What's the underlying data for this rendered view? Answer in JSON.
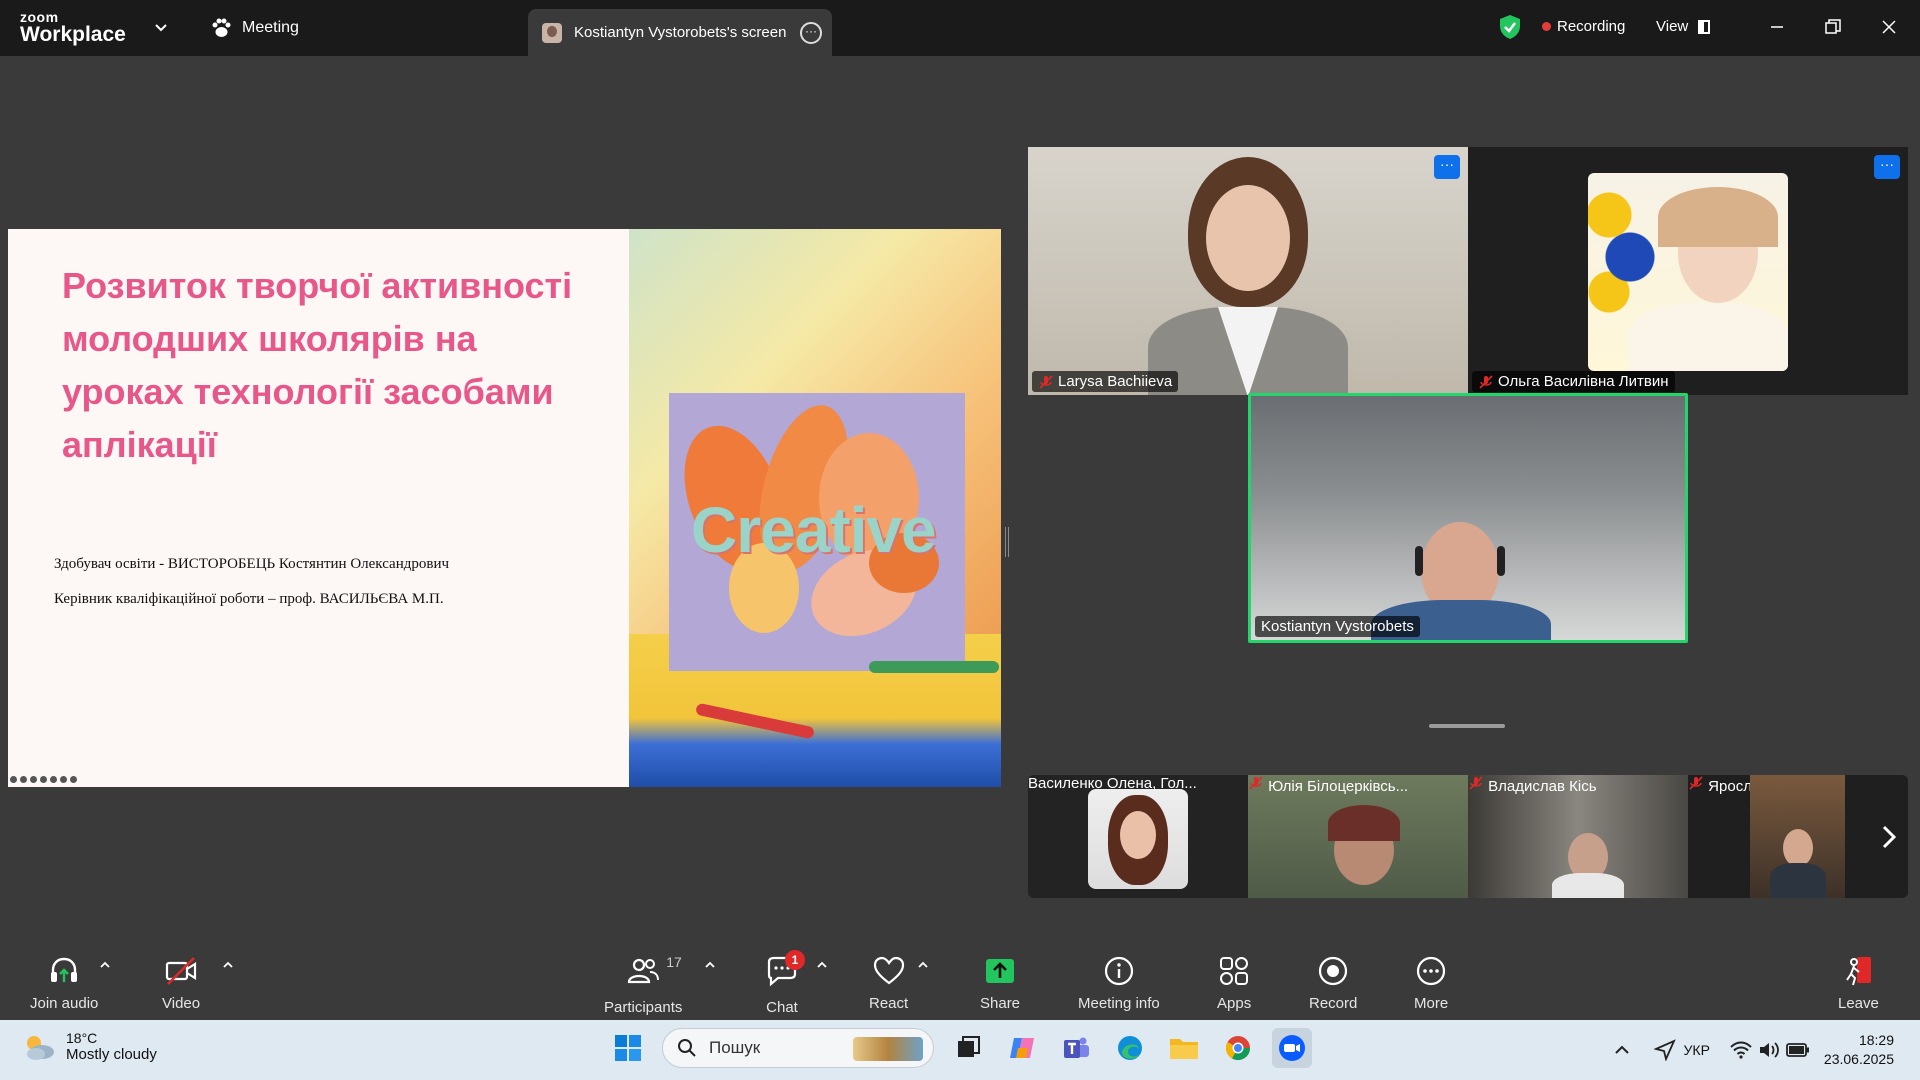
{
  "titlebar": {
    "logo_top": "zoom",
    "logo_bottom": "Workplace",
    "meeting_label": "Meeting",
    "screen_tab_label": "Kostiantyn Vystorobets's screen",
    "recording_label": "Recording",
    "view_label": "View",
    "colors": {
      "recording": "#e63b3b",
      "shield": "#22c55e",
      "bar": "#1a1a1a"
    }
  },
  "slide": {
    "title": "Розвиток творчої активності молодших школярів на уроках технології засобами аплікації",
    "student": "Здобувач освіти - ВИСТОРОБЕЦЬ  Костянтин  Олександрович",
    "advisor": "Керівник кваліфікаційної роботи – проф. ВАСИЛЬЄВА М.П.",
    "image_text": "Creative",
    "title_color": "#e8578a"
  },
  "tiles": {
    "larysa": {
      "name": "Larysa Bachiieva",
      "muted": true
    },
    "olga": {
      "name": "Ольга Василівна Литвин",
      "muted": true
    },
    "kostiantyn": {
      "name": "Kostiantyn Vystorobets",
      "muted": false,
      "active_speaker_color": "#23d56b"
    }
  },
  "strip": [
    {
      "name": "Василенко Олена, Гол...",
      "muted": false
    },
    {
      "name": "Юлія Білоцерківсь...",
      "muted": true
    },
    {
      "name": "Владислав Кісь",
      "muted": true
    },
    {
      "name": "Ярослав Соколов",
      "muted": true
    }
  ],
  "toolbar": {
    "join_audio": "Join audio",
    "video": "Video",
    "participants": "Participants",
    "participants_count": "17",
    "chat": "Chat",
    "chat_badge": "1",
    "react": "React",
    "share": "Share",
    "meeting_info": "Meeting info",
    "apps": "Apps",
    "record": "Record",
    "more": "More",
    "leave": "Leave",
    "colors": {
      "share": "#22c55e",
      "leave": "#e02828"
    }
  },
  "taskbar": {
    "temperature": "18°C",
    "condition": "Mostly cloudy",
    "search_placeholder": "Пошук",
    "language": "УКР",
    "time": "18:29",
    "date": "23.06.2025"
  }
}
